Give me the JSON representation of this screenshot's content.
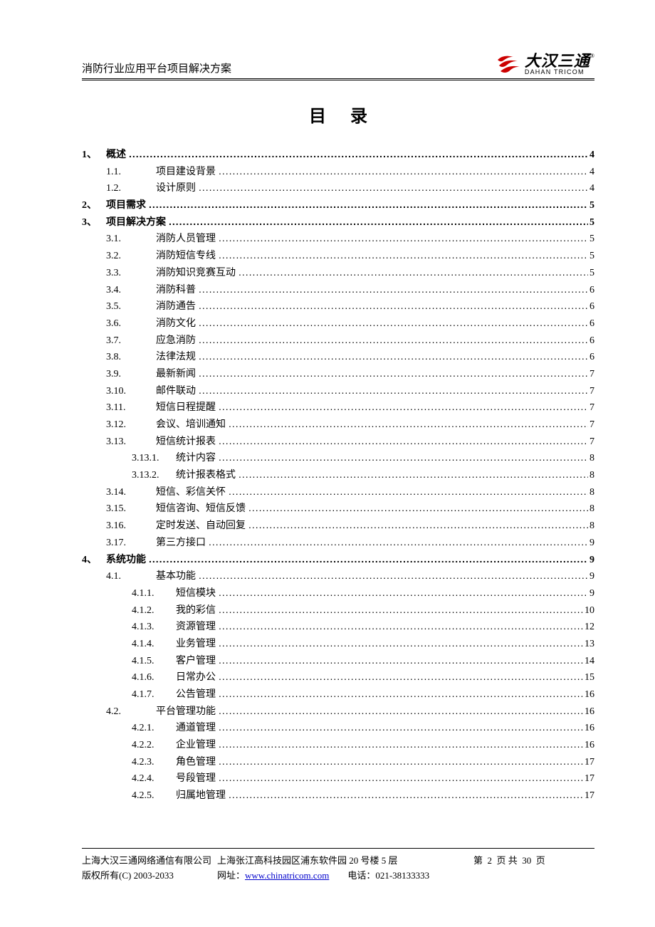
{
  "header": {
    "doc_title": "消防行业应用平台项目解决方案",
    "logo_cn": "大汉三通",
    "logo_en": "DAHAN TRICOM",
    "logo_reg": "®"
  },
  "toc_title": "目录",
  "toc": [
    {
      "level": 1,
      "num": "1、",
      "title": "概述",
      "page": "4"
    },
    {
      "level": 2,
      "num": "1.1.",
      "title": "项目建设背景",
      "page": "4"
    },
    {
      "level": 2,
      "num": "1.2.",
      "title": "设计原则",
      "page": "4"
    },
    {
      "level": 1,
      "num": "2、",
      "title": "项目需求",
      "page": "5"
    },
    {
      "level": 1,
      "num": "3、",
      "title": "项目解决方案",
      "page": "5"
    },
    {
      "level": 2,
      "num": "3.1.",
      "title": "消防人员管理",
      "page": "5"
    },
    {
      "level": 2,
      "num": "3.2.",
      "title": "消防短信专线",
      "page": "5"
    },
    {
      "level": 2,
      "num": "3.3.",
      "title": "消防知识竞赛互动",
      "page": "5"
    },
    {
      "level": 2,
      "num": "3.4.",
      "title": "消防科普",
      "page": "6"
    },
    {
      "level": 2,
      "num": "3.5.",
      "title": "消防通告",
      "page": "6"
    },
    {
      "level": 2,
      "num": "3.6.",
      "title": "消防文化",
      "page": "6"
    },
    {
      "level": 2,
      "num": "3.7.",
      "title": "应急消防",
      "page": "6"
    },
    {
      "level": 2,
      "num": "3.8.",
      "title": "法律法规",
      "page": "6"
    },
    {
      "level": 2,
      "num": "3.9.",
      "title": "最新新闻",
      "page": "7"
    },
    {
      "level": 2,
      "num": "3.10.",
      "title": "邮件联动",
      "page": "7"
    },
    {
      "level": 2,
      "num": "3.11.",
      "title": "短信日程提醒",
      "page": "7"
    },
    {
      "level": 2,
      "num": "3.12.",
      "title": "会议、培训通知",
      "page": "7"
    },
    {
      "level": 2,
      "num": "3.13.",
      "title": "短信统计报表",
      "page": "7"
    },
    {
      "level": 3,
      "num": "3.13.1.",
      "title": "统计内容",
      "page": "8"
    },
    {
      "level": 3,
      "num": "3.13.2.",
      "title": "统计报表格式",
      "page": "8"
    },
    {
      "level": 2,
      "num": "3.14.",
      "title": "短信、彩信关怀",
      "page": "8"
    },
    {
      "level": 2,
      "num": "3.15.",
      "title": "短信咨询、短信反馈",
      "page": "8"
    },
    {
      "level": 2,
      "num": "3.16.",
      "title": "定时发送、自动回复",
      "page": "8"
    },
    {
      "level": 2,
      "num": "3.17.",
      "title": "第三方接口",
      "page": "9"
    },
    {
      "level": 1,
      "num": "4、",
      "title": "系统功能",
      "page": "9"
    },
    {
      "level": 2,
      "num": "4.1.",
      "title": "基本功能",
      "page": "9"
    },
    {
      "level": 3,
      "num": "4.1.1.",
      "title": "短信模块",
      "page": "9"
    },
    {
      "level": 3,
      "num": "4.1.2.",
      "title": "我的彩信",
      "page": "10"
    },
    {
      "level": 3,
      "num": "4.1.3.",
      "title": "资源管理",
      "page": "12"
    },
    {
      "level": 3,
      "num": "4.1.4.",
      "title": "业务管理",
      "page": "13"
    },
    {
      "level": 3,
      "num": "4.1.5.",
      "title": "客户管理",
      "page": "14"
    },
    {
      "level": 3,
      "num": "4.1.6.",
      "title": "日常办公",
      "page": "15"
    },
    {
      "level": 3,
      "num": "4.1.7.",
      "title": "公告管理",
      "page": "16"
    },
    {
      "level": 2,
      "num": "4.2.",
      "title": "平台管理功能",
      "page": "16"
    },
    {
      "level": 3,
      "num": "4.2.1.",
      "title": "通道管理",
      "page": "16"
    },
    {
      "level": 3,
      "num": "4.2.2.",
      "title": "企业管理",
      "page": "16"
    },
    {
      "level": 3,
      "num": "4.2.3.",
      "title": "角色管理",
      "page": "17"
    },
    {
      "level": 3,
      "num": "4.2.4.",
      "title": "号段管理",
      "page": "17"
    },
    {
      "level": 3,
      "num": "4.2.5.",
      "title": "归属地管理",
      "page": "17"
    }
  ],
  "footer": {
    "company": "上海大汉三通网络通信有限公司",
    "address": "上海张江高科技园区浦东软件园 20 号楼 5 层",
    "page_label_prefix": "第",
    "page_current": "2",
    "page_label_mid": "页  共",
    "page_total": "30",
    "page_label_suffix": "页",
    "copyright": "版权所有(C) 2003-2033",
    "url_label": "网址：",
    "url": "www.chinatricom.com",
    "tel_label": "电话：",
    "tel": "021-38133333"
  }
}
